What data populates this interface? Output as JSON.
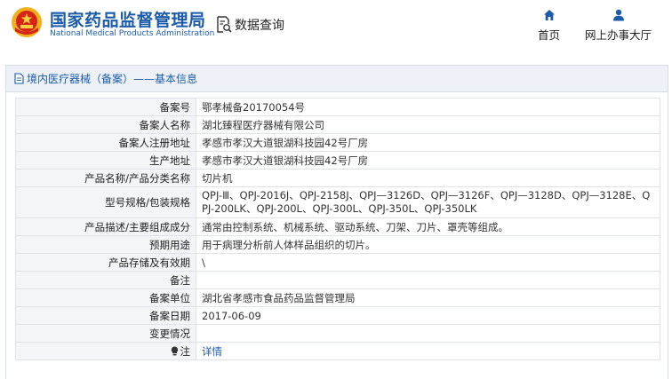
{
  "site": {
    "name_cn": "国家药品监督管理局",
    "name_en": "National Medical Products Administration",
    "emblem_icon": "national-emblem-icon"
  },
  "query": {
    "label": "数据查询",
    "icon": "data-query-icon"
  },
  "nav": [
    {
      "id": "home",
      "label": "首页",
      "icon": "home-icon"
    },
    {
      "id": "hall",
      "label": "网上办事大厅",
      "icon": "user-icon"
    }
  ],
  "panel": {
    "title": "境内医疗器械（备案）——基本信息",
    "icon": "document-icon"
  },
  "record": {
    "rows": [
      {
        "label": "备案号",
        "value": "鄂孝械备20170054号"
      },
      {
        "label": "备案人名称",
        "value": "湖北臻程医疗器械有限公司"
      },
      {
        "label": "备案人注册地址",
        "value": "孝感市孝汉大道银湖科技园42号厂房"
      },
      {
        "label": "生产地址",
        "value": "孝感市孝汉大道银湖科技园42号厂房"
      },
      {
        "label": "产品名称/产品分类名称",
        "value": "切片机"
      },
      {
        "label": "型号规格/包装规格",
        "value": "QPJ-Ⅲ、QPJ-2016J、QPJ-2158J、QPJ—3126D、QPJ—3126F、QPJ—3128D、QPJ—3128E、QPJ-200LK、QPJ-200L、QPJ-300L、QPJ-350L、QPJ-350LK"
      },
      {
        "label": "产品描述/主要组成成分",
        "value": "通常由控制系统、机械系统、驱动系统、刀架、刀片、罩壳等组成。"
      },
      {
        "label": "预期用途",
        "value": "用于病理分析前人体样品组织的切片。"
      },
      {
        "label": "产品存储及有效期",
        "value": "\\"
      },
      {
        "label": "备注",
        "value": ""
      },
      {
        "label": "备案单位",
        "value": "湖北省孝感市食品药品监督管理局"
      },
      {
        "label": "备案日期",
        "value": "2017-06-09"
      },
      {
        "label": "变更情况",
        "value": ""
      }
    ],
    "note_label": "注",
    "note_icon": "lightbulb-icon",
    "details_link": "详情"
  },
  "colors": {
    "brand_blue": "#1b5ba8",
    "label_bg": "#f3f5f8",
    "border": "#dfe3e8",
    "panel_header_bg": "#eef2f8"
  }
}
